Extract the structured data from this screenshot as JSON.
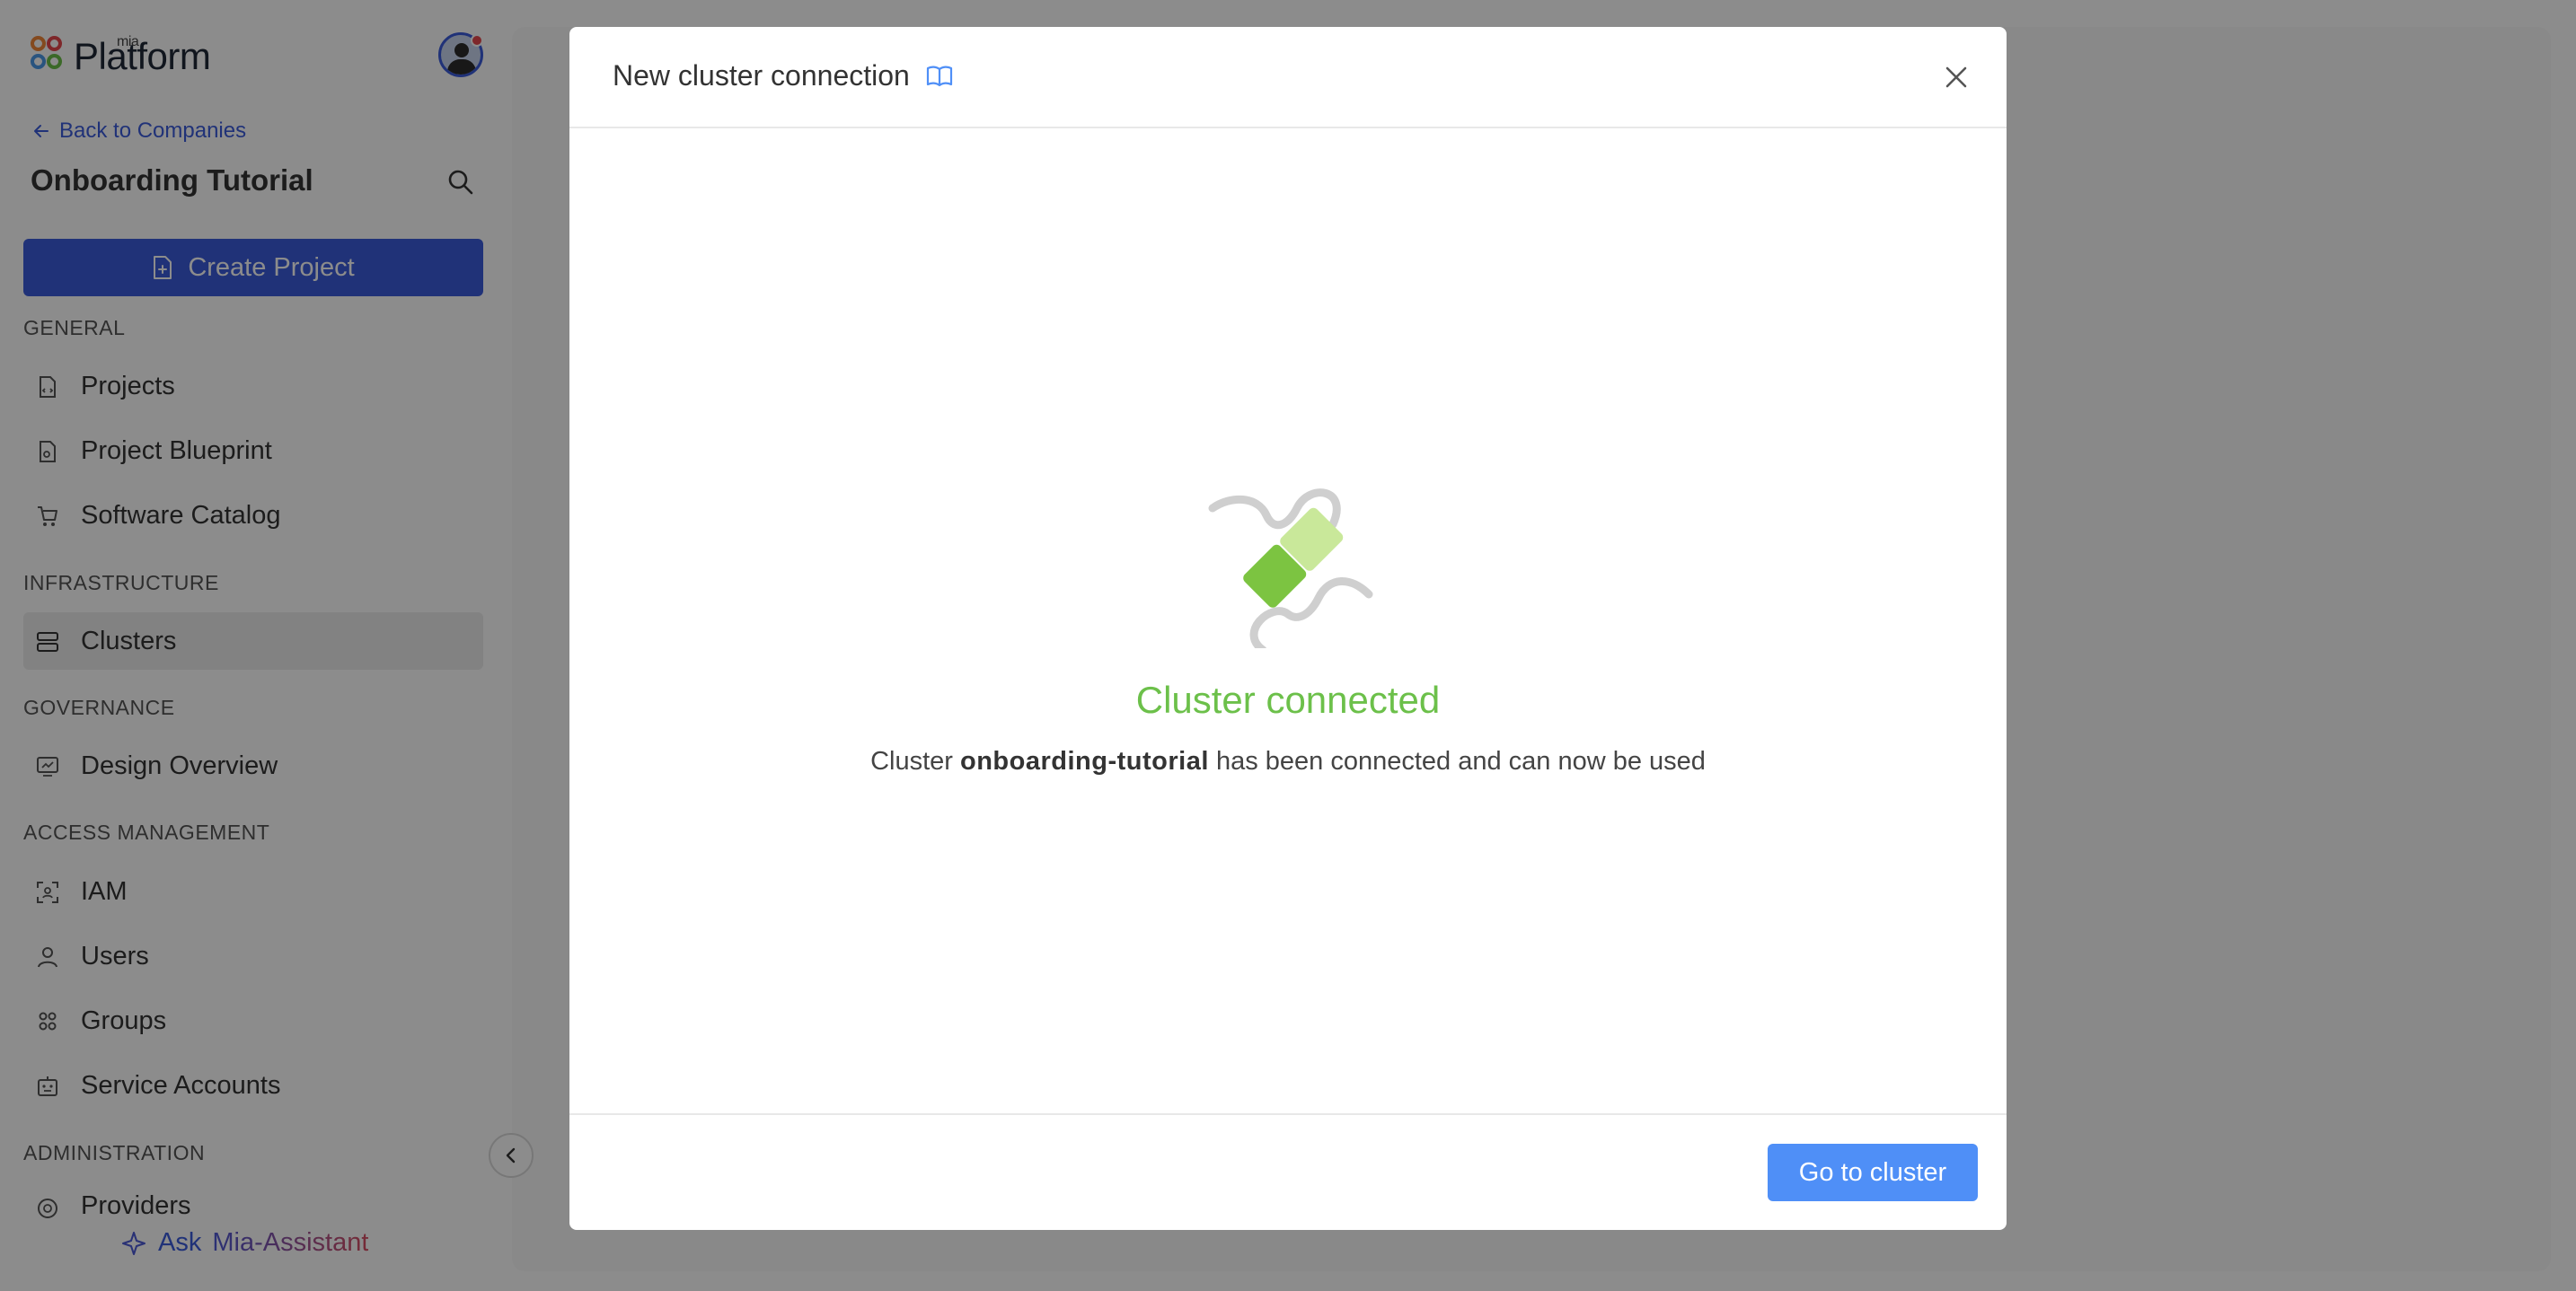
{
  "app": {
    "logo_small": "mia",
    "logo_text": "Platform"
  },
  "sidebar": {
    "back_link": "Back to Companies",
    "company_title": "Onboarding Tutorial",
    "create_button": "Create Project",
    "sections": {
      "general": "GENERAL",
      "infrastructure": "INFRASTRUCTURE",
      "governance": "GOVERNANCE",
      "access_management": "ACCESS MANAGEMENT",
      "administration": "ADMINISTRATION"
    },
    "items": {
      "projects": "Projects",
      "project_blueprint": "Project Blueprint",
      "software_catalog": "Software Catalog",
      "clusters": "Clusters",
      "design_overview": "Design Overview",
      "iam": "IAM",
      "users": "Users",
      "groups": "Groups",
      "service_accounts": "Service Accounts",
      "providers": "Providers"
    },
    "active_item": "Clusters",
    "assistant_ask": "Ask",
    "assistant_name": "Mia-Assistant"
  },
  "modal": {
    "title": "New cluster connection",
    "status_title": "Cluster connected",
    "desc_prefix": "Cluster",
    "cluster_name": "onboarding-tutorial",
    "desc_suffix": "has been connected and can now be used",
    "primary_button": "Go to cluster"
  },
  "colors": {
    "brand_blue": "#3b5bdb",
    "button_blue": "#4f8ff7",
    "success_green": "#6cc04a"
  }
}
